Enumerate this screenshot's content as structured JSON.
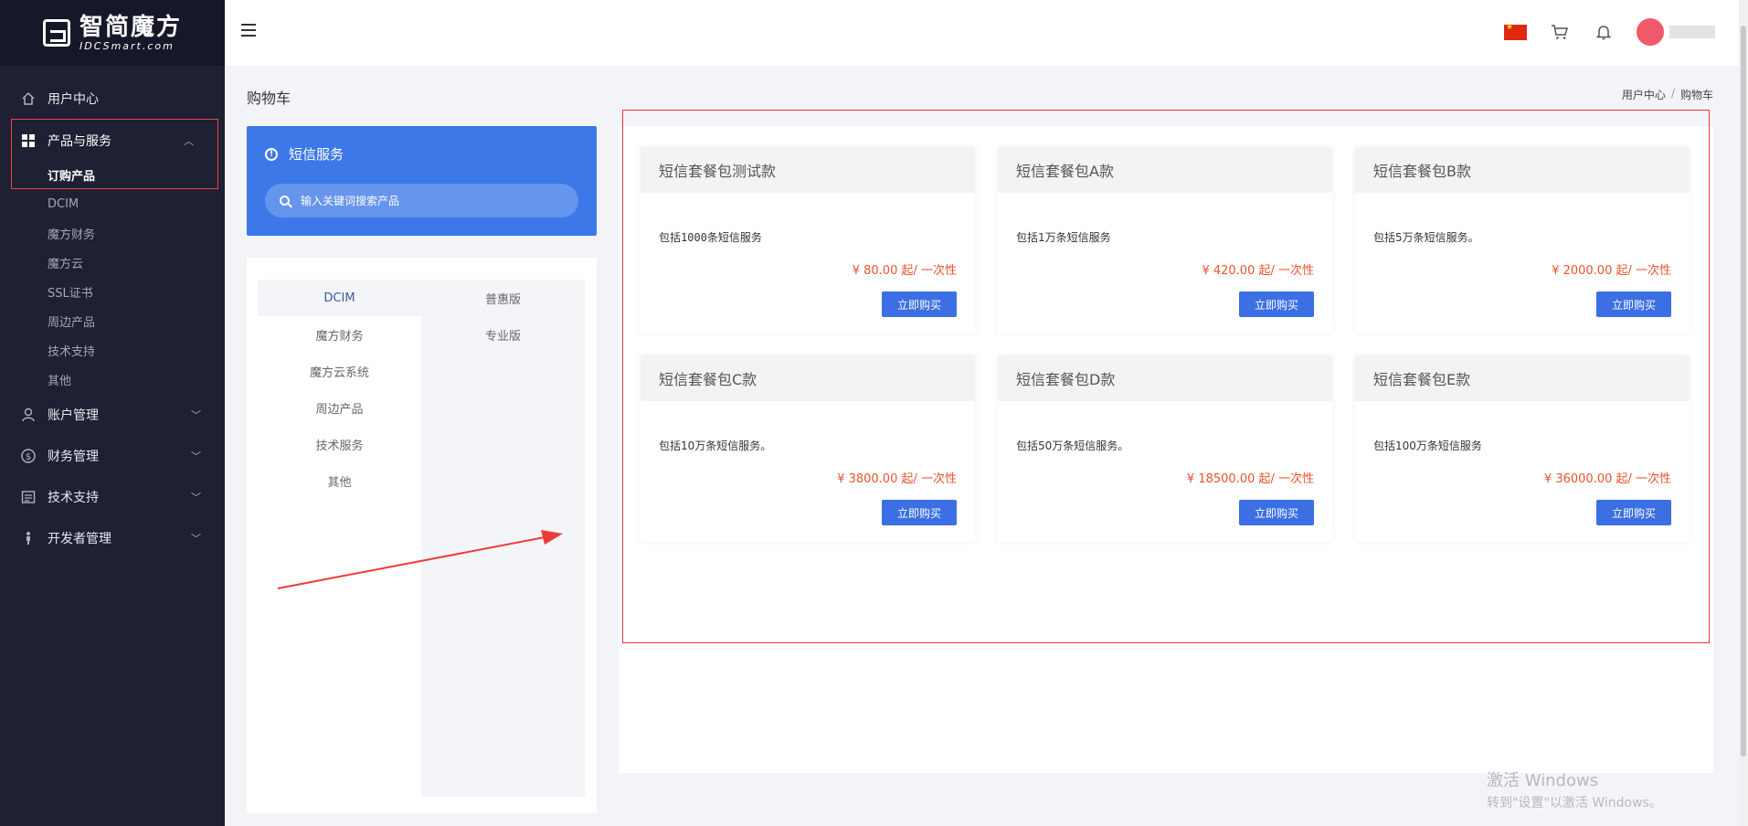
{
  "logo": {
    "cn": "智简魔方",
    "en": "IDCSmart.com"
  },
  "sidebar": {
    "items": [
      {
        "label": "用户中心",
        "icon": "home-icon"
      },
      {
        "label": "产品与服务",
        "icon": "grid-icon"
      },
      {
        "label": "账户管理",
        "icon": "user-icon"
      },
      {
        "label": "财务管理",
        "icon": "dollar-icon"
      },
      {
        "label": "技术支持",
        "icon": "ticket-icon"
      },
      {
        "label": "开发者管理",
        "icon": "developer-icon"
      }
    ],
    "subitems": [
      "订购产品",
      "DCIM",
      "魔方财务",
      "魔方云",
      "SSL证书",
      "周边产品",
      "技术支持",
      "其他"
    ]
  },
  "page": {
    "title": "购物车",
    "breadcrumb": [
      "用户中心",
      "购物车"
    ]
  },
  "service": {
    "title": "短信服务",
    "search_placeholder": "输入关键词搜索产品"
  },
  "categories": {
    "col1": [
      "DCIM",
      "魔方财务",
      "魔方云系统",
      "周边产品",
      "技术服务",
      "其他"
    ],
    "col2": [
      "普惠版",
      "专业版"
    ]
  },
  "products": [
    {
      "name": "短信套餐包测试款",
      "desc": "包括1000条短信服务",
      "price": "¥ 80.00 起/ 一次性",
      "button": "立即购买"
    },
    {
      "name": "短信套餐包A款",
      "desc": "包括1万条短信服务",
      "price": "¥ 420.00 起/ 一次性",
      "button": "立即购买"
    },
    {
      "name": "短信套餐包B款",
      "desc": "包括5万条短信服务。",
      "price": "¥ 2000.00 起/ 一次性",
      "button": "立即购买"
    },
    {
      "name": "短信套餐包C款",
      "desc": "包括10万条短信服务。",
      "price": "¥ 3800.00 起/ 一次性",
      "button": "立即购买"
    },
    {
      "name": "短信套餐包D款",
      "desc": "包括50万条短信服务。",
      "price": "¥ 18500.00 起/ 一次性",
      "button": "立即购买"
    },
    {
      "name": "短信套餐包E款",
      "desc": "包括100万条短信服务",
      "price": "¥ 36000.00 起/ 一次性",
      "button": "立即购买"
    }
  ],
  "watermark": {
    "line1": "激活 Windows",
    "line2": "转到\"设置\"以激活 Windows。"
  },
  "colors": {
    "sidebar": "#1e2033",
    "accent": "#3c78e8",
    "price": "#e8542c",
    "annotation": "#e33333"
  }
}
